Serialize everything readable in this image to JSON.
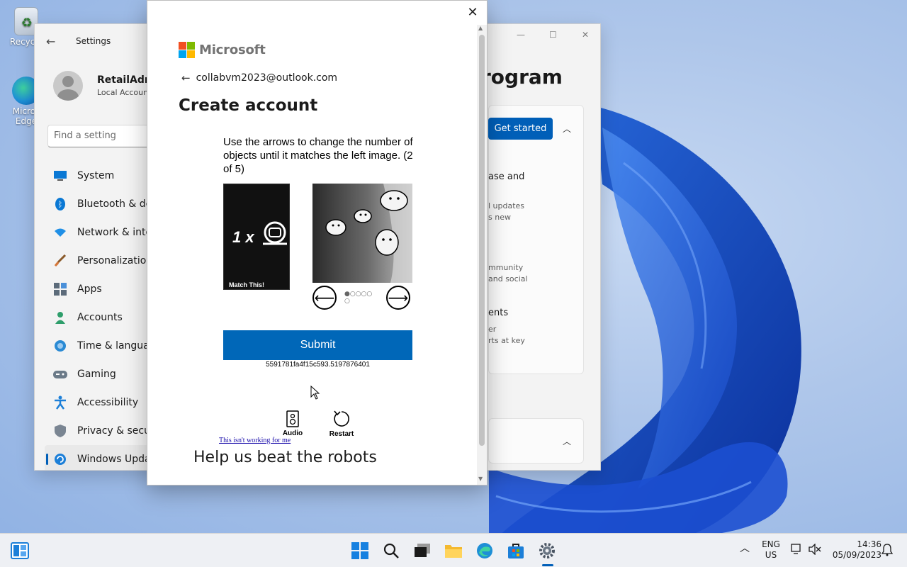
{
  "desktop": {
    "icons": [
      {
        "label": "Recycle"
      },
      {
        "label": "Micros Edge"
      }
    ]
  },
  "settings": {
    "title": "Settings",
    "user_name": "RetailAdmi",
    "user_sub": "Local Accoun",
    "search_placeholder": "Find a setting",
    "nav": [
      {
        "label": "System"
      },
      {
        "label": "Bluetooth & dev"
      },
      {
        "label": "Network & inter"
      },
      {
        "label": "Personalization"
      },
      {
        "label": "Apps"
      },
      {
        "label": "Accounts"
      },
      {
        "label": "Time & languag"
      },
      {
        "label": "Gaming"
      },
      {
        "label": "Accessibility"
      },
      {
        "label": "Privacy & securi"
      },
      {
        "label": "Windows Updat"
      }
    ],
    "right_title": "rogram",
    "get_started": "Get started",
    "right_texts": [
      "ase and",
      "l updates",
      "s new",
      "mmunity",
      "and social",
      "ents",
      "er",
      "rts at key"
    ]
  },
  "dialog": {
    "brand": "Microsoft",
    "email": "collabvm2023@outlook.com",
    "title": "Create account",
    "instructions": "Use the arrows to change the number of objects until it matches the left image. (2 of 5)",
    "match_label": "Match This!",
    "match_symbol": "1 x",
    "dots_row1": "●○○○○",
    "dots_row2": "○",
    "submit": "Submit",
    "session_id": "5591781fa4f15c593.5197876401",
    "audio": "Audio",
    "restart": "Restart",
    "not_working": "This isn't working for me",
    "robots": "Help us beat the robots"
  },
  "taskbar": {
    "lang_top": "ENG",
    "lang_bottom": "US",
    "time": "14:36",
    "date": "05/09/2023"
  },
  "colors": {
    "accent": "#005fb8",
    "submit": "#0067b8",
    "ms_red": "#f25022",
    "ms_green": "#7fba00",
    "ms_blue": "#00a4ef",
    "ms_yellow": "#ffb900"
  }
}
